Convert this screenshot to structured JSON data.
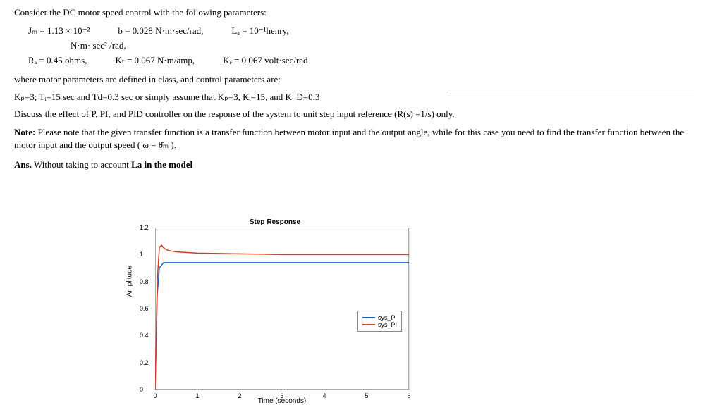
{
  "intro": "Consider the DC motor speed control with the following parameters:",
  "params": {
    "Jm_label": "Jₘ = 1.13 × 10⁻²",
    "Jm_units": "N·m· sec² /rad,",
    "b": "b = 0.028 N·m·sec/rad,",
    "La": "Lₐ = 10⁻¹henry,",
    "Ra": "Rₐ = 0.45 ohms,",
    "Kt": "Kₜ = 0.067 N·m/amp,",
    "Ke": "Kₑ = 0.067 volt·sec/rad"
  },
  "where_text": "where motor parameters are defined in class, and control parameters are:",
  "control_params": "Kₚ=3; Tᵢ=15 sec and Td=0.3 sec or simply assume that Kₚ=3, Kᵢ=15, and K_D=0.3",
  "discuss": "Discuss the effect of P, PI, and PID controller on the response of the system to unit step input reference (R(s) =1/s) only.",
  "note_label": "Note:",
  "note_text": " Please note that the given transfer function is a transfer function between motor input and the output angle, while for this case you need to find the transfer function between the motor input and the output speed ( ω = θ̇ₘ ).",
  "answer_label": "Ans.",
  "answer_text": " Without taking to account ",
  "answer_bold": "La in the model",
  "chart_data": {
    "type": "line",
    "title": "Step Response",
    "xlabel": "Time (seconds)",
    "ylabel": "Amplitude",
    "xlim": [
      0,
      6
    ],
    "ylim": [
      0,
      1.2
    ],
    "xticks": [
      0,
      1,
      2,
      3,
      4,
      5,
      6
    ],
    "yticks": [
      0,
      0.2,
      0.4,
      0.6,
      0.8,
      1,
      1.2
    ],
    "series": [
      {
        "name": "sys_P",
        "color": "#2060d0",
        "x": [
          0,
          0.05,
          0.1,
          0.2,
          0.5,
          1,
          2,
          3,
          4,
          5,
          6
        ],
        "y": [
          0,
          0.7,
          0.9,
          0.94,
          0.94,
          0.94,
          0.94,
          0.94,
          0.94,
          0.94,
          0.94
        ]
      },
      {
        "name": "sys_PI",
        "color": "#d04020",
        "x": [
          0,
          0.05,
          0.1,
          0.15,
          0.2,
          0.3,
          0.5,
          1,
          2,
          3,
          4,
          5,
          6
        ],
        "y": [
          0,
          0.8,
          1.05,
          1.07,
          1.05,
          1.03,
          1.02,
          1.01,
          1.005,
          1.0,
          1.0,
          1.0,
          1.0
        ]
      }
    ]
  }
}
